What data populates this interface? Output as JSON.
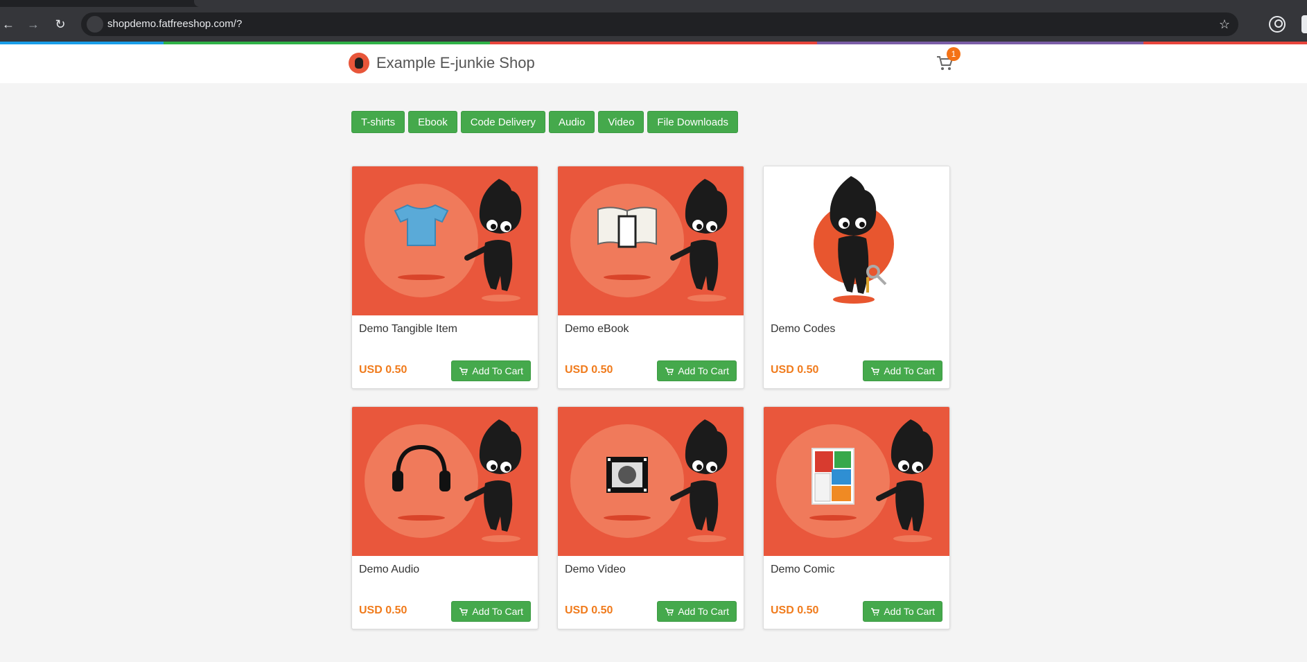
{
  "browser": {
    "url": "shopdemo.fatfreeshop.com/?",
    "strip_colors": [
      "#1a9ee8",
      "#2fb247",
      "#2fb247",
      "#e8453c",
      "#e8453c",
      "#7b5ea7",
      "#7b5ea7",
      "#e8453c"
    ]
  },
  "header": {
    "title": "Example E-junkie Shop",
    "cart_count": "1"
  },
  "categories": [
    "T-shirts",
    "Ebook",
    "Code Delivery",
    "Audio",
    "Video",
    "File Downloads"
  ],
  "products": [
    {
      "name": "Demo Tangible Item",
      "price": "USD 0.50",
      "button": "Add To Cart",
      "icon": "tshirt-icon"
    },
    {
      "name": "Demo eBook",
      "price": "USD 0.50",
      "button": "Add To Cart",
      "icon": "book-icon"
    },
    {
      "name": "Demo Codes",
      "price": "USD 0.50",
      "button": "Add To Cart",
      "icon": "key-icon"
    },
    {
      "name": "Demo Audio",
      "price": "USD 0.50",
      "button": "Add To Cart",
      "icon": "headphones-icon"
    },
    {
      "name": "Demo Video",
      "price": "USD 0.50",
      "button": "Add To Cart",
      "icon": "film-icon"
    },
    {
      "name": "Demo Comic",
      "price": "USD 0.50",
      "button": "Add To Cart",
      "icon": "comic-icon"
    }
  ],
  "colors": {
    "accent_green": "#45a94c",
    "price_orange": "#f07b1c",
    "card_red": "#e9573c"
  }
}
